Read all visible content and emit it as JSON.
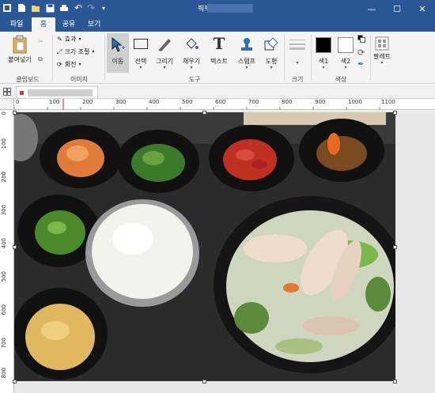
{
  "titlebar": {
    "title": "픽픽 -",
    "quick_access": [
      "file-menu-icon",
      "new-icon",
      "open-icon",
      "save-icon",
      "print-icon",
      "undo-icon",
      "redo-icon",
      "customize-icon"
    ],
    "minimize_glyph": "—",
    "maximize_glyph": "☐",
    "close_glyph": "✕"
  },
  "tabs": [
    "파일",
    "홈",
    "공유",
    "보기"
  ],
  "active_tab": "홈",
  "ribbon": {
    "clipboard": {
      "paste": "붙여넣기",
      "group": "클립보드"
    },
    "image": {
      "effect": "효과",
      "resize": "크기 조절",
      "rotate": "회전",
      "group": "이미지"
    },
    "tools": {
      "move": "이동",
      "select": "선택",
      "draw": "그리기",
      "fill": "채우기",
      "text": "텍스트",
      "stamp": "스탬프",
      "shape": "도형",
      "group": "도구"
    },
    "size": {
      "group": "크기"
    },
    "color": {
      "color1": "색1",
      "color2": "색2",
      "group": "색상",
      "color1_value": "#000000",
      "color2_value": "#ffffff"
    },
    "palette": {
      "label": "팔레트"
    }
  },
  "ruler": {
    "h_ticks": [
      "0",
      "100",
      "200",
      "300",
      "400",
      "500",
      "600",
      "700",
      "800",
      "900",
      "1000",
      "1100"
    ],
    "v_ticks": [
      "0",
      "100",
      "200",
      "300",
      "400",
      "500",
      "600",
      "700",
      "800"
    ]
  },
  "colors": {
    "accent": "#2b5797",
    "ribbon_bg": "#f4f4f4",
    "canvas_bg": "#e8e8e8"
  }
}
